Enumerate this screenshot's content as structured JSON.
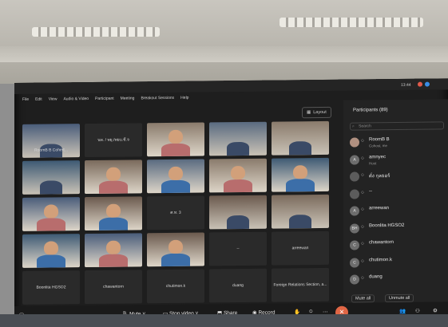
{
  "menu": [
    "File",
    "Edit",
    "View",
    "Audio & Video",
    "Participant",
    "Meeting",
    "Breakout Sessions",
    "Help"
  ],
  "top_right": {
    "layout_label": "Layout",
    "time": "13:44"
  },
  "gallery": {
    "tiles": [
      {
        "name": "RoomB B Cohert...",
        "kind": "room"
      },
      {
        "name": "นพ. / พยุ./พยบ.ชี.จ",
        "kind": "blank"
      },
      {
        "name": "",
        "kind": "person"
      },
      {
        "name": "",
        "kind": "room"
      },
      {
        "name": "",
        "kind": "room"
      },
      {
        "name": "",
        "kind": "room"
      },
      {
        "name": "",
        "kind": "person"
      },
      {
        "name": "",
        "kind": "person"
      },
      {
        "name": "",
        "kind": "person"
      },
      {
        "name": "",
        "kind": "person"
      },
      {
        "name": "",
        "kind": "person"
      },
      {
        "name": "",
        "kind": "person"
      },
      {
        "name": "ศ.ท. 3",
        "kind": "blank"
      },
      {
        "name": "",
        "kind": "room"
      },
      {
        "name": "",
        "kind": "room"
      },
      {
        "name": "",
        "kind": "person"
      },
      {
        "name": "",
        "kind": "person"
      },
      {
        "name": "",
        "kind": "person"
      },
      {
        "name": "--",
        "kind": "blank"
      },
      {
        "name": "arreewan",
        "kind": "blank"
      },
      {
        "name": "Boonlita HGSO2",
        "kind": "blank"
      },
      {
        "name": "chawantorn",
        "kind": "blank"
      },
      {
        "name": "chutimon.k",
        "kind": "blank"
      },
      {
        "name": "duang",
        "kind": "blank"
      },
      {
        "name": "Foreign Relations Section, a...",
        "kind": "blank"
      }
    ]
  },
  "participants": {
    "title": "Participants (89)",
    "search_placeholder": "Search",
    "list": [
      {
        "name": "RoomB B",
        "sub": "Cohost, me",
        "initial": ""
      },
      {
        "name": "amnyec",
        "sub": "Host",
        "initial": "A"
      },
      {
        "name": "ดั่ง กุลธอร์",
        "sub": "",
        "initial": ""
      },
      {
        "name": "--",
        "sub": "",
        "initial": ""
      },
      {
        "name": "arreewan",
        "sub": "",
        "initial": "A"
      },
      {
        "name": "Boonlita HGSO2",
        "sub": "",
        "initial": "BH"
      },
      {
        "name": "chawantorn",
        "sub": "",
        "initial": "C"
      },
      {
        "name": "chutimon.k",
        "sub": "",
        "initial": "C"
      },
      {
        "name": "duang",
        "sub": "",
        "initial": "D"
      }
    ],
    "mute_all": "Mute all",
    "unmute_all": "Unmute all"
  },
  "toolbar": {
    "mute": "Mute",
    "stop_video": "Stop video",
    "share": "Share",
    "record": "Record"
  },
  "colors": {
    "end_button": "#e06645",
    "panel_bg": "#232323",
    "screen_bg": "#1e1e1e"
  }
}
